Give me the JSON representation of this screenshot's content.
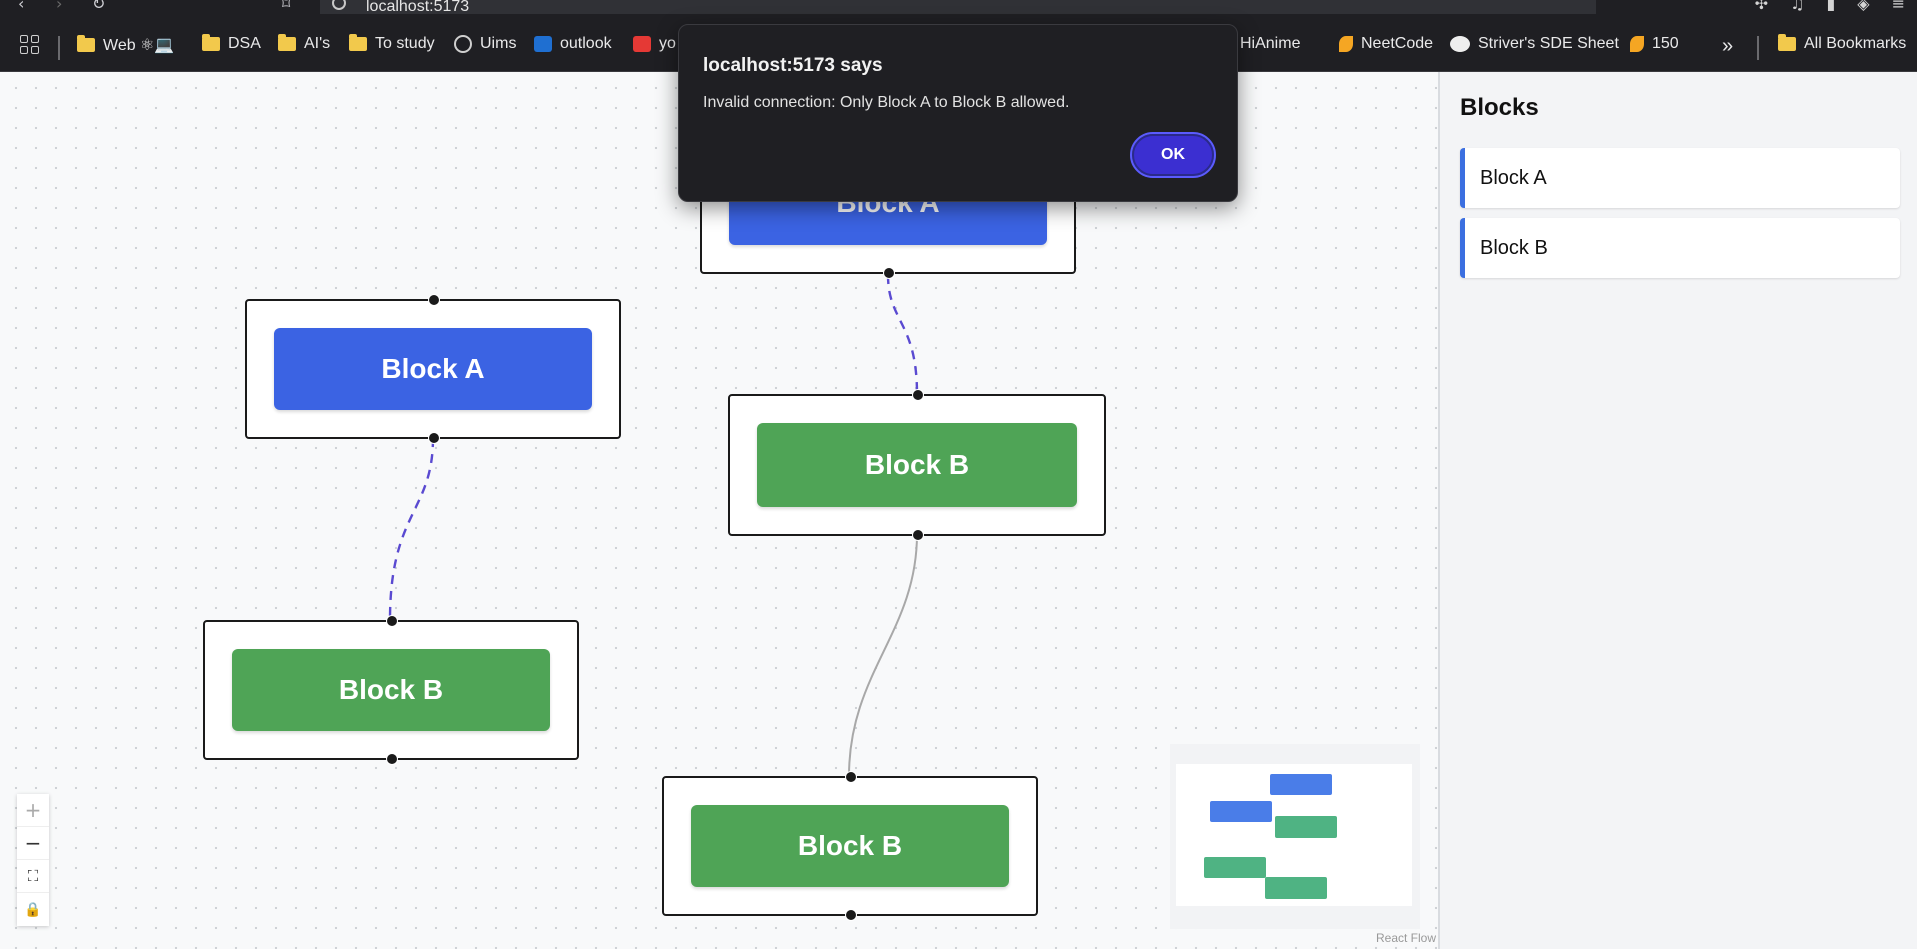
{
  "browser": {
    "url": "localhost:5173",
    "bookmarks": [
      {
        "label": "Web ⚛💻",
        "icon": "folder-icon"
      },
      {
        "label": "DSA",
        "icon": "folder-icon"
      },
      {
        "label": "AI's",
        "icon": "folder-icon"
      },
      {
        "label": "To study",
        "icon": "folder-icon"
      },
      {
        "label": "Uims",
        "icon": "globe-icon"
      },
      {
        "label": "outlook",
        "icon": "outlook-icon"
      },
      {
        "label": "yo",
        "icon": "youtube-icon"
      },
      {
        "label": "HiAnime",
        "icon": "hianime-icon"
      },
      {
        "label": "NeetCode",
        "icon": "neetcode-icon"
      },
      {
        "label": "Striver's SDE Sheet",
        "icon": "tuf-icon"
      },
      {
        "label": "150",
        "icon": "neetcode-icon"
      },
      {
        "label": "All Bookmarks",
        "icon": "folder-icon"
      }
    ],
    "more_label": "»"
  },
  "dialog": {
    "title": "localhost:5173 says",
    "message": "Invalid connection: Only Block A to Block B allowed.",
    "ok_label": "OK"
  },
  "sidebar": {
    "title": "Blocks",
    "items": [
      {
        "label": "Block A"
      },
      {
        "label": "Block B"
      }
    ]
  },
  "nodes": [
    {
      "label": "Block A",
      "type": "a"
    },
    {
      "label": "Block A",
      "type": "a"
    },
    {
      "label": "Block B",
      "type": "b"
    },
    {
      "label": "Block B",
      "type": "b"
    },
    {
      "label": "Block B",
      "type": "b"
    }
  ],
  "colors": {
    "block_a": "#3b63e3",
    "block_b": "#4fa456",
    "edge_animated": "#5a4ad1",
    "edge_default": "#a8a8a8",
    "dialog_ok": "#3b2fd1"
  },
  "controls": [
    "zoom-in",
    "zoom-out",
    "fit-view",
    "lock"
  ],
  "attribution": "React Flow"
}
